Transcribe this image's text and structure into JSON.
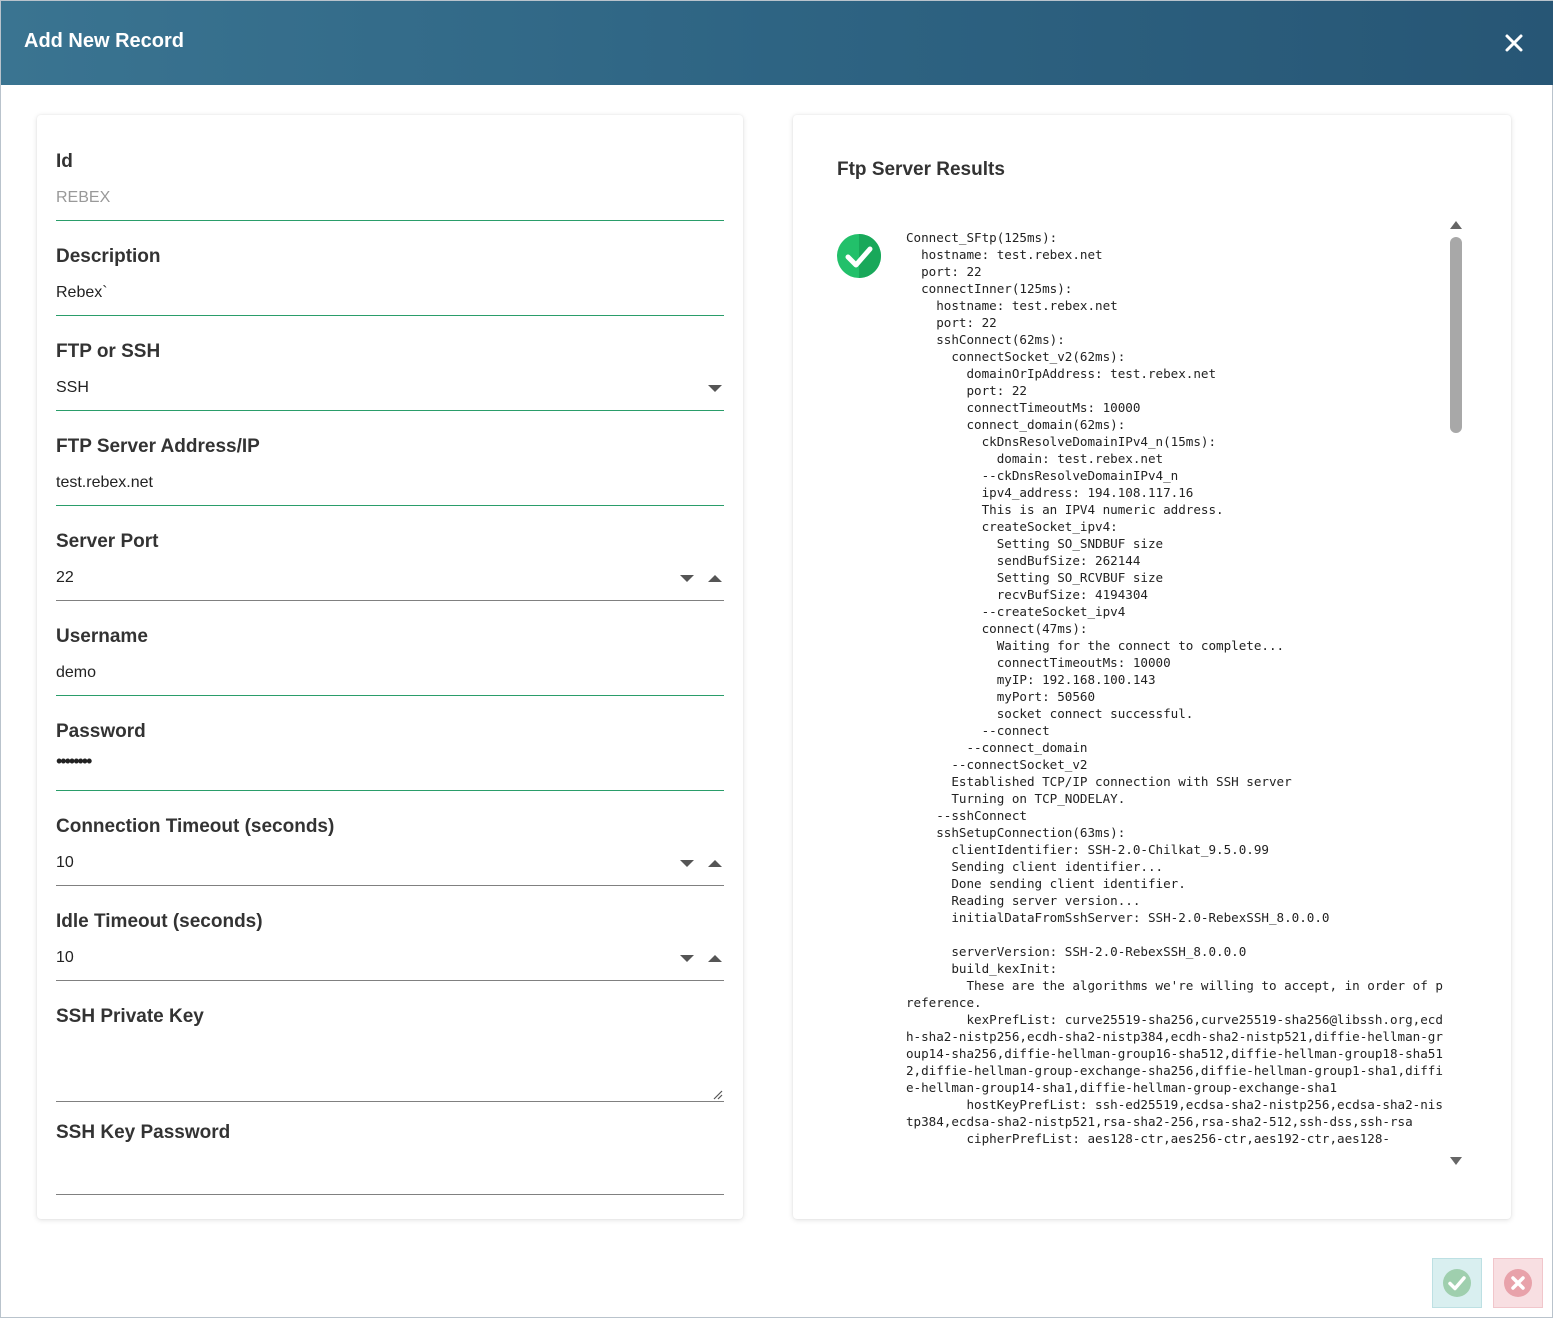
{
  "dialog": {
    "title": "Add New Record",
    "close_icon": "close-icon"
  },
  "form": {
    "id": {
      "label": "Id",
      "value": "REBEX"
    },
    "description": {
      "label": "Description",
      "value": "Rebex`"
    },
    "protocol": {
      "label": "FTP or SSH",
      "value": "SSH"
    },
    "server_address": {
      "label": "FTP Server Address/IP",
      "value": "test.rebex.net"
    },
    "server_port": {
      "label": "Server Port",
      "value": "22"
    },
    "username": {
      "label": "Username",
      "value": "demo"
    },
    "password": {
      "label": "Password",
      "value": "••••••••"
    },
    "connection_timeout": {
      "label": "Connection Timeout (seconds)",
      "value": "10"
    },
    "idle_timeout": {
      "label": "Idle Timeout (seconds)",
      "value": "10"
    },
    "ssh_private_key": {
      "label": "SSH Private Key",
      "value": ""
    },
    "ssh_key_password": {
      "label": "SSH Key Password",
      "value": ""
    }
  },
  "results": {
    "title": "Ftp Server Results",
    "status_icon": "success-check-icon",
    "log": "Connect_SFtp(125ms):\n  hostname: test.rebex.net\n  port: 22\n  connectInner(125ms):\n    hostname: test.rebex.net\n    port: 22\n    sshConnect(62ms):\n      connectSocket_v2(62ms):\n        domainOrIpAddress: test.rebex.net\n        port: 22\n        connectTimeoutMs: 10000\n        connect_domain(62ms):\n          ckDnsResolveDomainIPv4_n(15ms):\n            domain: test.rebex.net\n          --ckDnsResolveDomainIPv4_n\n          ipv4_address: 194.108.117.16\n          This is an IPV4 numeric address.\n          createSocket_ipv4:\n            Setting SO_SNDBUF size\n            sendBufSize: 262144\n            Setting SO_RCVBUF size\n            recvBufSize: 4194304\n          --createSocket_ipv4\n          connect(47ms):\n            Waiting for the connect to complete...\n            connectTimeoutMs: 10000\n            myIP: 192.168.100.143\n            myPort: 50560\n            socket connect successful.\n          --connect\n        --connect_domain\n      --connectSocket_v2\n      Established TCP/IP connection with SSH server\n      Turning on TCP_NODELAY.\n    --sshConnect\n    sshSetupConnection(63ms):\n      clientIdentifier: SSH-2.0-Chilkat_9.5.0.99\n      Sending client identifier...\n      Done sending client identifier.\n      Reading server version...\n      initialDataFromSshServer: SSH-2.0-RebexSSH_8.0.0.0\n\n      serverVersion: SSH-2.0-RebexSSH_8.0.0.0\n      build_kexInit:\n        These are the algorithms we're willing to accept, in order of preference.\n        kexPrefList: curve25519-sha256,curve25519-sha256@libssh.org,ecdh-sha2-nistp256,ecdh-sha2-nistp384,ecdh-sha2-nistp521,diffie-hellman-group14-sha256,diffie-hellman-group16-sha512,diffie-hellman-group18-sha512,diffie-hellman-group-exchange-sha256,diffie-hellman-group1-sha1,diffie-hellman-group14-sha1,diffie-hellman-group-exchange-sha1\n        hostKeyPrefList: ssh-ed25519,ecdsa-sha2-nistp256,ecdsa-sha2-nistp384,ecdsa-sha2-nistp521,rsa-sha2-256,rsa-sha2-512,ssh-dss,ssh-rsa\n        cipherPrefList: aes128-ctr,aes256-ctr,aes192-ctr,aes128-"
  },
  "footer": {
    "ok_icon": "check-circle-icon",
    "cancel_icon": "cancel-circle-icon"
  },
  "colors": {
    "header_start": "#3a7491",
    "header_end": "#275675",
    "accent_underline": "#2a9d6a",
    "success": "#22c06a"
  }
}
